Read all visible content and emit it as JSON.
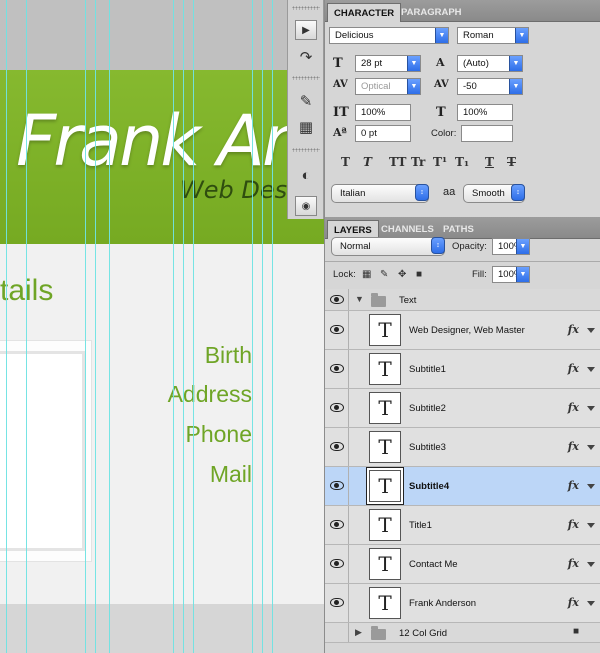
{
  "canvas": {
    "heading": "Frank An",
    "subheading": "Web Desig",
    "section_title": "tails",
    "labels": [
      "Birth",
      "Address",
      "Phone",
      "Mail"
    ]
  },
  "character_panel": {
    "tabs": [
      "CHARACTER",
      "PARAGRAPH"
    ],
    "font_family": "Delicious",
    "font_style": "Roman",
    "font_size": "28 pt",
    "leading": "(Auto)",
    "kerning": "Optical",
    "tracking": "-50",
    "vertical_scale": "100%",
    "horizontal_scale": "100%",
    "baseline_shift": "0 pt",
    "color_label": "Color:",
    "style_buttons": [
      "T",
      "T",
      "TT",
      "Tr",
      "T¹",
      "T₁",
      "T",
      "T"
    ],
    "language": "Italian",
    "aa_icon_text": "aa",
    "antialias": "Smooth"
  },
  "layers_panel": {
    "tabs": [
      "LAYERS",
      "CHANNELS",
      "PATHS"
    ],
    "blend_mode": "Normal",
    "opacity_label": "Opacity:",
    "opacity": "100%",
    "lock_label": "Lock:",
    "fill_label": "Fill:",
    "fill": "100%",
    "group_name": "Text",
    "layers": [
      {
        "name": "Web Designer, Web Master",
        "selected": false
      },
      {
        "name": "Subtitle1",
        "selected": false
      },
      {
        "name": "Subtitle2",
        "selected": false
      },
      {
        "name": "Subtitle3",
        "selected": false
      },
      {
        "name": "Subtitle4",
        "selected": true
      },
      {
        "name": "Title1",
        "selected": false
      },
      {
        "name": "Contact Me",
        "selected": false
      },
      {
        "name": "Frank Anderson",
        "selected": false
      }
    ],
    "bottom_group": "12 Col Grid",
    "fx_label": "fx",
    "thumb_glyph": "T"
  },
  "colors": {
    "brand_green": "#7ab128",
    "guide_cyan": "#6fe3e3",
    "selection_blue": "#bcd6f7"
  }
}
